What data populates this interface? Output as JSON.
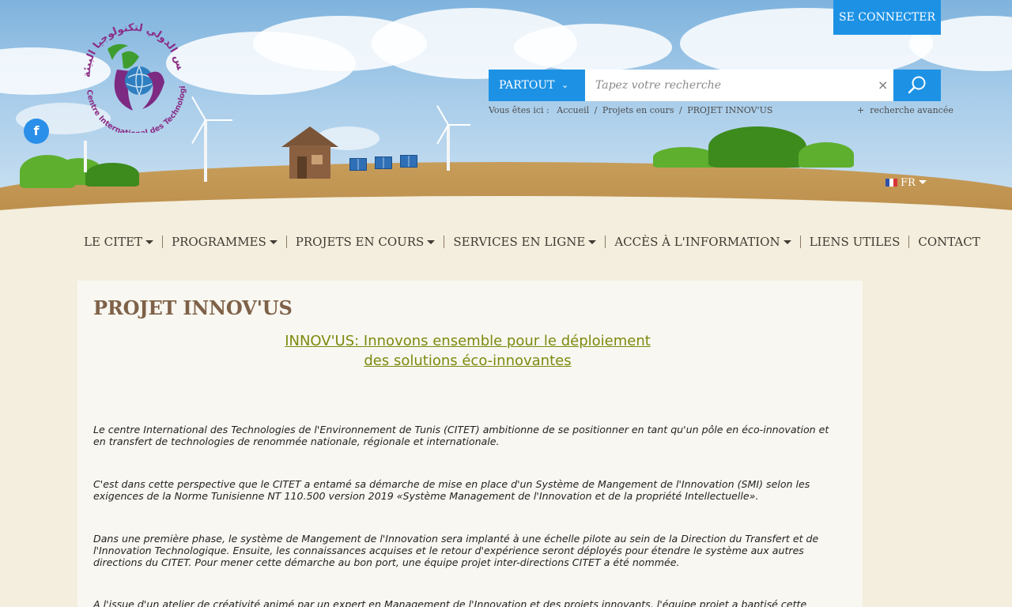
{
  "header": {
    "login_label": "SE CONNECTER",
    "search": {
      "scope_label": "PARTOUT",
      "placeholder": "Tapez votre recherche",
      "advanced_label": "recherche avancée"
    },
    "breadcrumb": {
      "prefix": "Vous êtes ici :",
      "items": [
        "Accueil",
        "Projets en cours",
        "PROJET INNOV'US"
      ],
      "separator": "/"
    },
    "language": "FR",
    "social": [
      "facebook"
    ]
  },
  "nav": {
    "items": [
      {
        "label": "LE CITET",
        "dropdown": true
      },
      {
        "label": "PROGRAMMES",
        "dropdown": true
      },
      {
        "label": "PROJETS EN COURS",
        "dropdown": true
      },
      {
        "label": "SERVICES EN LIGNE",
        "dropdown": true
      },
      {
        "label": "ACCÈS À L'INFORMATION",
        "dropdown": true
      },
      {
        "label": "LIENS UTILES",
        "dropdown": false
      },
      {
        "label": "CONTACT",
        "dropdown": false
      }
    ]
  },
  "logo": {
    "text": "Centre International des Technologies de l'Environnement de Tunis"
  },
  "main": {
    "title": "PROJET INNOV'US",
    "subtitle_line1": "INNOV'US: Innovons ensemble pour le déploiement",
    "subtitle_line2": "des solutions éco-innovantes",
    "paragraphs": [
      "Le centre International des Technologies de l'Environnement de Tunis (CITET) ambitionne de se positionner en tant qu'un pôle en éco-innovation et en transfert de technologies de renommée nationale, régionale et internationale.",
      "C'est dans cette perspective que  le CITET a  entamé sa démarche de mise en place d'un Système de Mangement de l'Innovation (SMI) selon les exigences de la Norme Tunisienne NT 110.500 version 2019 «Système Management de l'Innovation et de la propriété Intellectuelle».",
      "Dans une première phase, le système de Mangement de l'Innovation sera implanté à une échelle pilote au sein de la Direction du Transfert et de l'Innovation Technologique. Ensuite, les connaissances acquises et le retour d'expérience seront déployés pour étendre le système aux autres directions du CITET. Pour mener cette démarche au bon port, une équipe projet inter-directions CITET a été nommée.",
      "A l'issue d'un atelier de créativité animé par un expert en Management de l'Innovation et des projets innovants, l'équipe projet a baptisé cette"
    ]
  },
  "colors": {
    "accent": "#1d92e5",
    "title": "#7e6148",
    "subtitle": "#7c8a0e",
    "background": "#f3eedd"
  }
}
